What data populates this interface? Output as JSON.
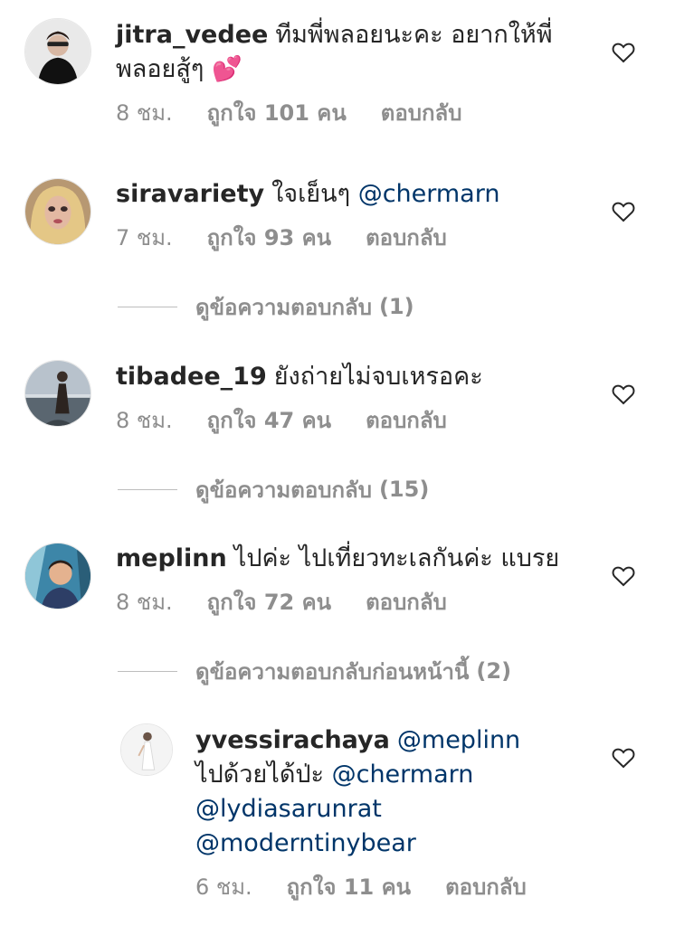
{
  "comments": [
    {
      "username": "jitra_vedee",
      "text": "ทีมพี่พลอยนะคะ อยากให้พี่พลอยสู้ๆ 💕",
      "time": "8 ชม.",
      "likes": "ถูกใจ 101 คน",
      "reply": "ตอบกลับ"
    },
    {
      "username": "siravariety",
      "text": "ใจเย็นๆ",
      "mention": "@chermarn",
      "time": "7 ชม.",
      "likes": "ถูกใจ 93 คน",
      "reply": "ตอบกลับ",
      "view_replies": "ดูข้อความตอบกลับ",
      "view_replies_count": "(1)"
    },
    {
      "username": "tibadee_19",
      "text": "ยังถ่ายไม่จบเหรอคะ",
      "time": "8 ชม.",
      "likes": "ถูกใจ 47 คน",
      "reply": "ตอบกลับ",
      "view_replies": "ดูข้อความตอบกลับ",
      "view_replies_count": "(15)"
    },
    {
      "username": "meplinn",
      "text": "ไปค่ะ ไปเที่ยวทะเลกันค่ะ แบรย",
      "time": "8 ชม.",
      "likes": "ถูกใจ 72 คน",
      "reply": "ตอบกลับ",
      "view_replies": "ดูข้อความตอบกลับก่อนหน้านี้",
      "view_replies_count": "(2)"
    }
  ],
  "reply_comment": {
    "username": "yvessirachaya",
    "mention1": "@meplinn",
    "text": "ไปด้วยได้ป่ะ",
    "mention2": "@chermarn",
    "mention3": "@lydiasarunrat",
    "mention4": "@moderntinybear",
    "time": "6 ชม.",
    "likes": "ถูกใจ 11 คน",
    "reply": "ตอบกลับ"
  },
  "icons": {
    "like": "heart-outline-icon"
  },
  "colors": {
    "text": "#262626",
    "secondary": "#8e8e8e",
    "mention": "#003569"
  }
}
